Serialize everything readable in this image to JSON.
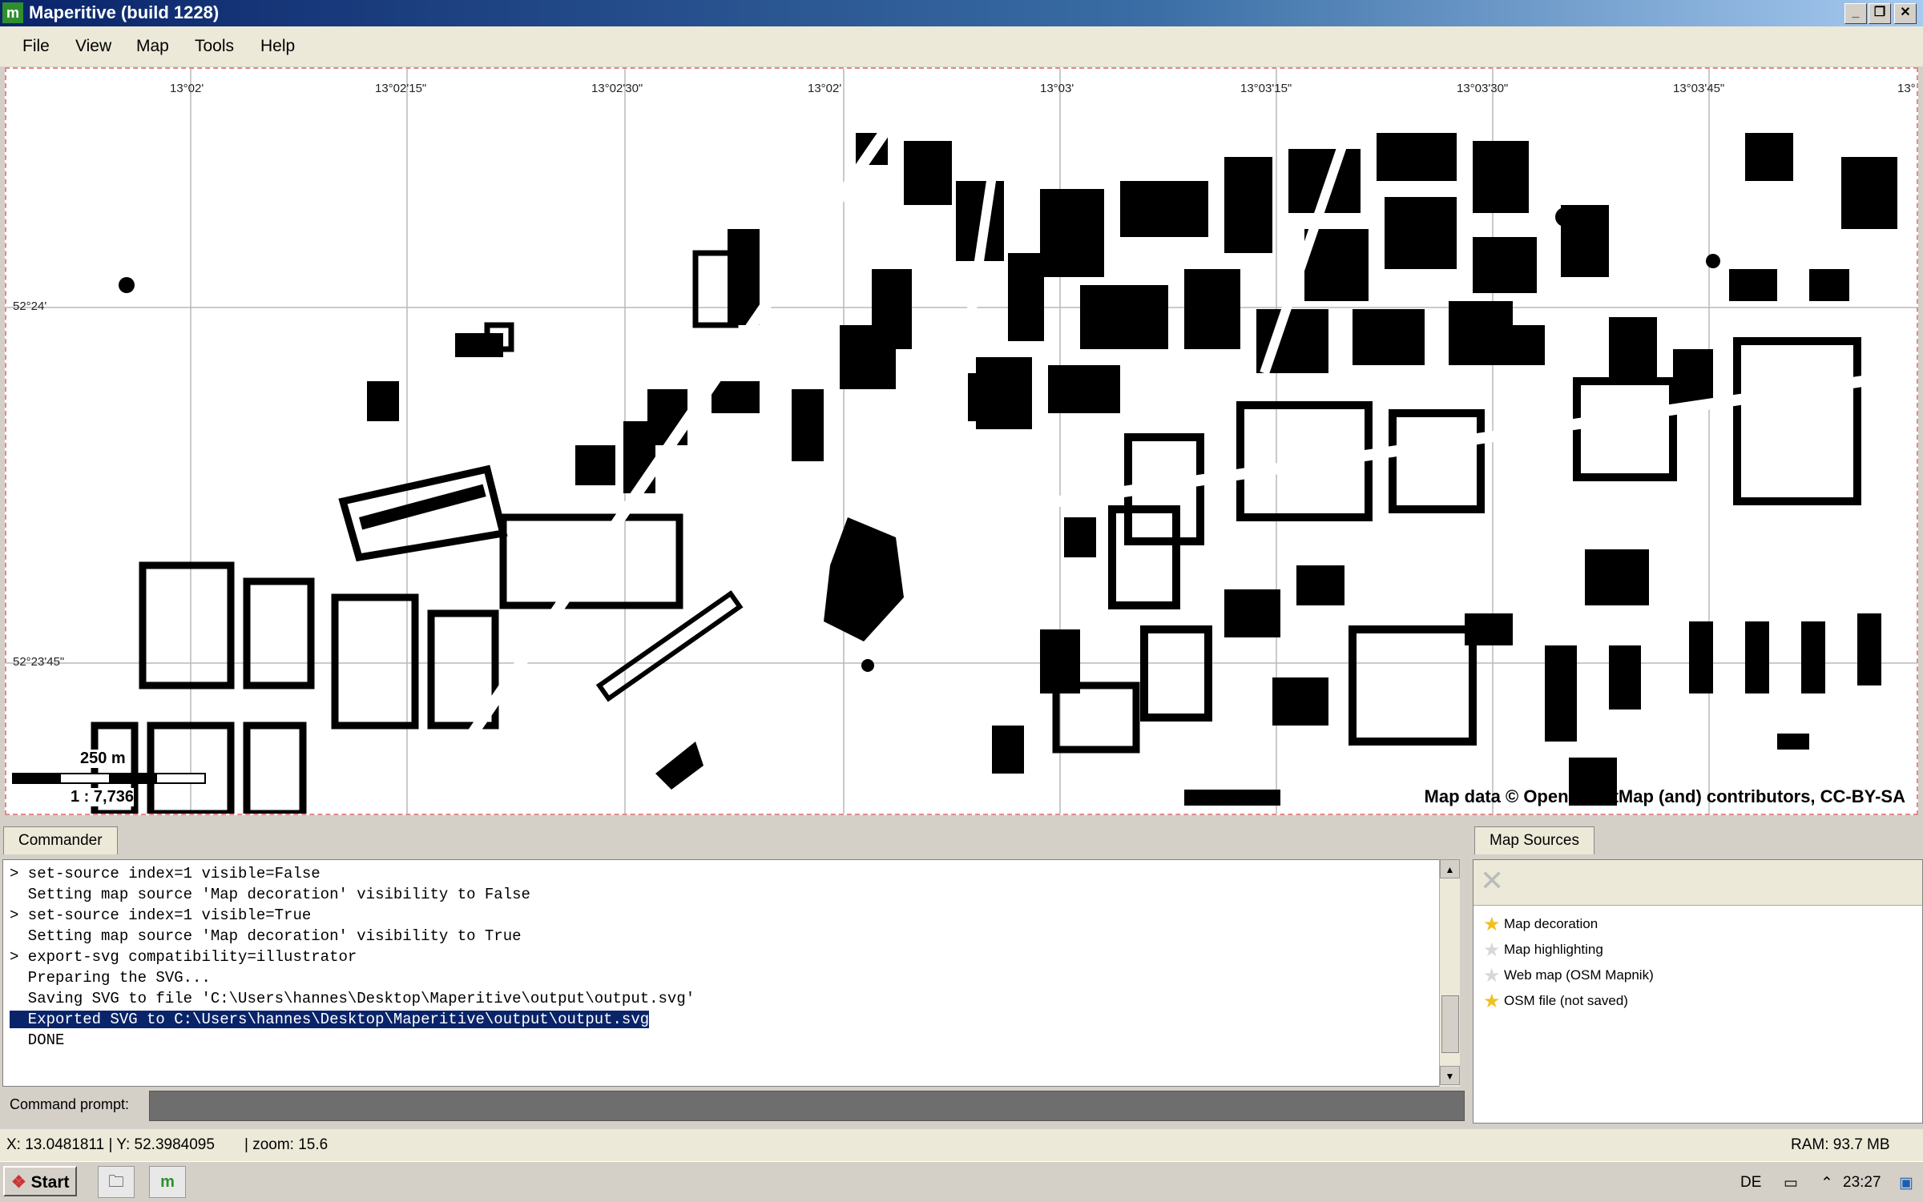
{
  "window": {
    "title": "Maperitive (build 1228)",
    "app_icon": "m",
    "controls": [
      "_",
      "❐",
      "✕"
    ]
  },
  "menu": [
    "File",
    "View",
    "Map",
    "Tools",
    "Help"
  ],
  "map": {
    "grid_labels_top": [
      "13°02'",
      "13°02'15\"",
      "13°02'30\"",
      "13°02'",
      "13°03'",
      "13°03'15\"",
      "13°03'30\"",
      "13°03'45\"",
      "13°"
    ],
    "grid_labels_left": [
      "52°24'",
      "52°23'45\""
    ],
    "scale_distance": "250 m",
    "scale_ratio": "1 : 7,736",
    "attribution": "Map data © OpenStreetMap (and) contributors, CC-BY-SA"
  },
  "commander": {
    "tab_label": "Commander",
    "lines": [
      "> set-source index=1 visible=False",
      "  Setting map source 'Map decoration' visibility to False",
      "> set-source index=1 visible=True",
      "  Setting map source 'Map decoration' visibility to True",
      "> export-svg compatibility=illustrator",
      "  Preparing the SVG...",
      "  Saving SVG to file 'C:\\Users\\hannes\\Desktop\\Maperitive\\output\\output.svg'",
      "  Exported SVG to C:\\Users\\hannes\\Desktop\\Maperitive\\output\\output.svg",
      "  DONE"
    ],
    "prompt_label": "Command prompt:"
  },
  "map_sources": {
    "tab_label": "Map Sources",
    "items": [
      {
        "label": "Map decoration",
        "active": true
      },
      {
        "label": "Map highlighting",
        "active": false
      },
      {
        "label": "Web map (OSM Mapnik)",
        "active": false
      },
      {
        "label": "OSM file (not saved)",
        "active": true
      }
    ]
  },
  "status": {
    "coords": "X: 13.0481811 | Y: 52.3984095",
    "zoom": "| zoom: 15.6",
    "ram": "RAM: 93.7 MB"
  },
  "taskbar": {
    "start_label": "Start",
    "language": "DE",
    "time": "23:27"
  }
}
